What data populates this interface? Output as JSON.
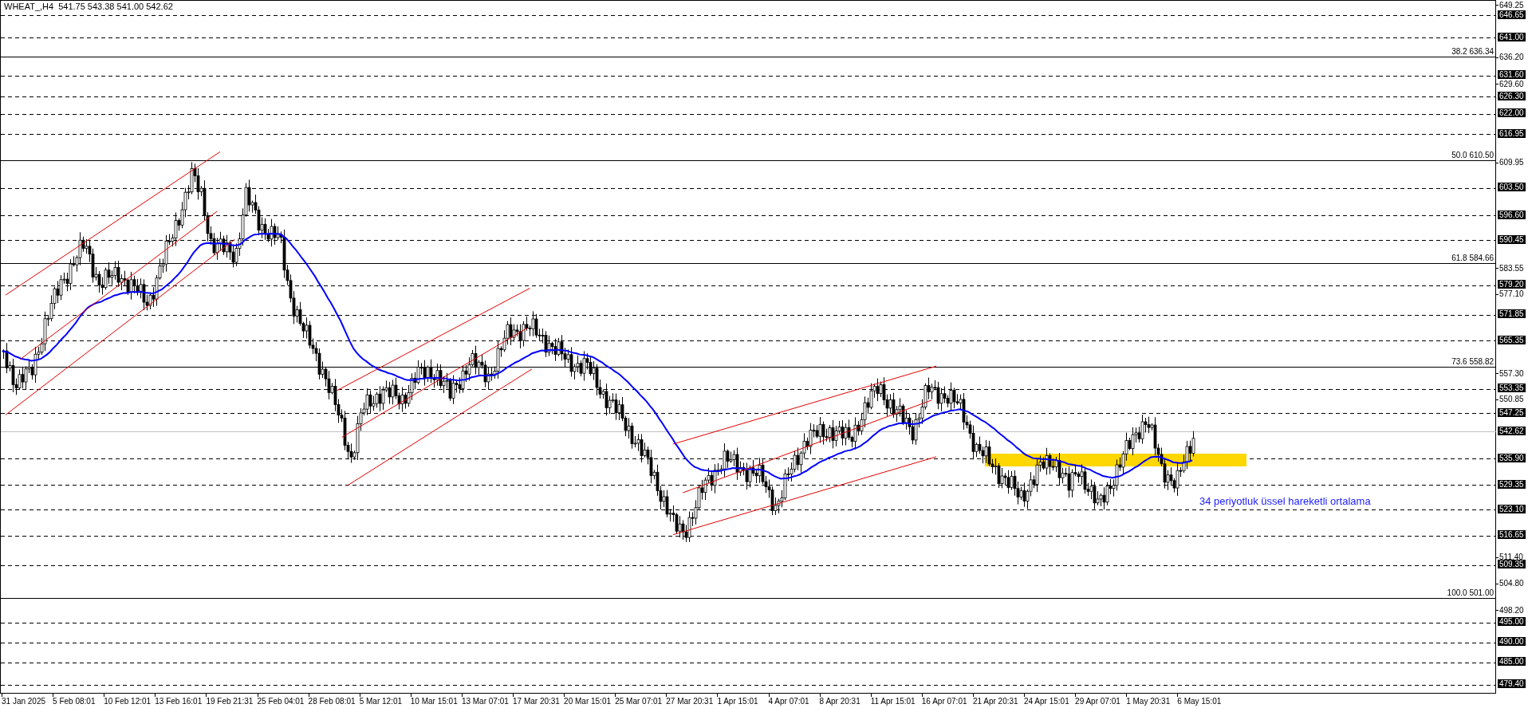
{
  "header": {
    "symbol": "WHEAT_,H4",
    "quote": "541.75 543.38 541.00 542.62"
  },
  "price_axis": [
    "649.25",
    "636.20",
    "629.60",
    "609.95",
    "583.55",
    "577.10",
    "557.30",
    "550.85",
    "511.40",
    "504.80",
    "498.20"
  ],
  "levels": [
    {
      "price": "646.65",
      "kind": "dashed"
    },
    {
      "price": "641.00",
      "kind": "dashed"
    },
    {
      "price": "631.60",
      "kind": "dashed"
    },
    {
      "price": "626.30",
      "kind": "dashed"
    },
    {
      "price": "622.00",
      "kind": "dashed"
    },
    {
      "price": "616.95",
      "kind": "dashed"
    },
    {
      "price": "603.50",
      "kind": "dashed"
    },
    {
      "price": "596.60",
      "kind": "dashed"
    },
    {
      "price": "590.45",
      "kind": "dashed"
    },
    {
      "price": "579.20",
      "kind": "dashed"
    },
    {
      "price": "571.85",
      "kind": "dashed"
    },
    {
      "price": "565.35",
      "kind": "dashed"
    },
    {
      "price": "553.35",
      "kind": "dashed"
    },
    {
      "price": "547.25",
      "kind": "dashed"
    },
    {
      "price": "542.62",
      "kind": "current"
    },
    {
      "price": "535.90",
      "kind": "dashed"
    },
    {
      "price": "529.35",
      "kind": "dashed"
    },
    {
      "price": "523.10",
      "kind": "dashed"
    },
    {
      "price": "516.65",
      "kind": "dashed"
    },
    {
      "price": "509.35",
      "kind": "dashed"
    },
    {
      "price": "495.00",
      "kind": "dashed"
    },
    {
      "price": "490.00",
      "kind": "dashed"
    },
    {
      "price": "485.00",
      "kind": "dashed"
    },
    {
      "price": "479.40",
      "kind": "dashed"
    }
  ],
  "fibonacci": [
    "38.2 636.34",
    "50.0 610.50",
    "61.8 584.66",
    "73.6 558.82",
    "100.0 501.00"
  ],
  "annotation": "34 periyotluk üssel hareketli ortalama",
  "time_axis": [
    "31 Jan 2025",
    "5 Feb 08:01",
    "10 Feb 12:01",
    "13 Feb 16:01",
    "19 Feb 21:31",
    "25 Feb 04:01",
    "28 Feb 08:01",
    "5 Mar 12:01",
    "10 Mar 15:01",
    "13 Mar 07:01",
    "17 Mar 20:31",
    "20 Mar 15:01",
    "25 Mar 07:01",
    "27 Mar 20:31",
    "1 Apr 15:01",
    "4 Apr 07:01",
    "8 Apr 20:31",
    "11 Apr 15:01",
    "16 Apr 07:01",
    "21 Apr 20:31",
    "24 Apr 15:01",
    "29 Apr 07:01",
    "1 May 20:31",
    "6 May 15:01"
  ]
}
